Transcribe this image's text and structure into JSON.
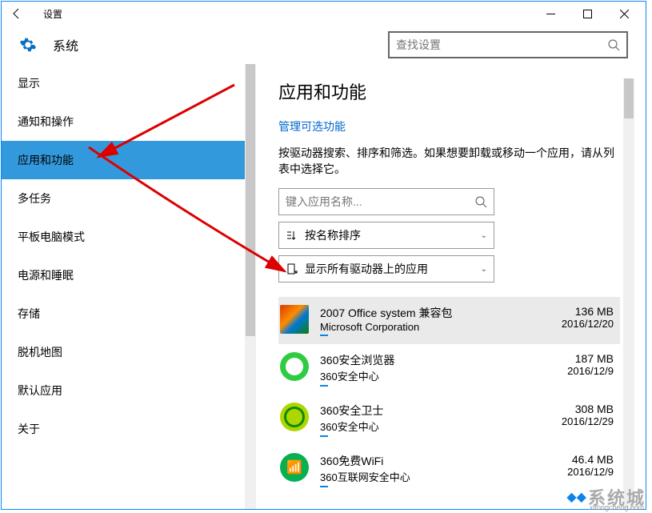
{
  "window": {
    "title": "设置"
  },
  "header": {
    "title": "系统",
    "search_placeholder": "查找设置"
  },
  "sidebar": {
    "items": [
      {
        "label": "显示"
      },
      {
        "label": "通知和操作"
      },
      {
        "label": "应用和功能"
      },
      {
        "label": "多任务"
      },
      {
        "label": "平板电脑模式"
      },
      {
        "label": "电源和睡眠"
      },
      {
        "label": "存储"
      },
      {
        "label": "脱机地图"
      },
      {
        "label": "默认应用"
      },
      {
        "label": "关于"
      }
    ],
    "selected_index": 2
  },
  "content": {
    "title": "应用和功能",
    "manage_link": "管理可选功能",
    "description": "按驱动器搜索、排序和筛选。如果想要卸载或移动一个应用，请从列表中选择它。",
    "search_placeholder": "键入应用名称...",
    "sort_label": "按名称排序",
    "filter_label": "显示所有驱动器上的应用",
    "apps": [
      {
        "name": "2007 Office system 兼容包",
        "publisher": "Microsoft Corporation",
        "size": "136 MB",
        "date": "2016/12/20",
        "icon": "office"
      },
      {
        "name": "360安全浏览器",
        "publisher": "360安全中心",
        "size": "187 MB",
        "date": "2016/12/9",
        "icon": "360browser"
      },
      {
        "name": "360安全卫士",
        "publisher": "360安全中心",
        "size": "308 MB",
        "date": "2016/12/29",
        "icon": "360guard"
      },
      {
        "name": "360免费WiFi",
        "publisher": "360互联网安全中心",
        "size": "46.4 MB",
        "date": "2016/12/9",
        "icon": "360wifi"
      }
    ],
    "selected_app_index": 0
  },
  "watermark": {
    "text_main": "系统城",
    "text_sub": "xitongcheng.com"
  }
}
